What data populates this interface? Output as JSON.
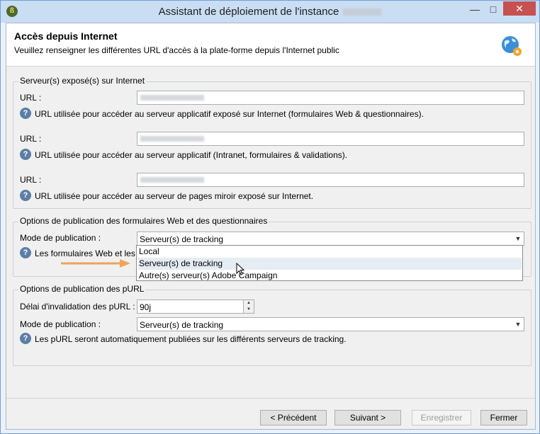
{
  "window": {
    "title": "Assistant de déploiement de l'instance",
    "title_suffix_redacted": ""
  },
  "header": {
    "title": "Accès depuis Internet",
    "subtitle": "Veuillez renseigner les différentes URL d'accès à la plate-forme depuis l'Internet public"
  },
  "servers": {
    "legend": "Serveur(s) exposé(s) sur Internet",
    "rows": [
      {
        "label": "URL :",
        "help": "URL utilisée pour accéder au serveur applicatif exposé sur Internet (formulaires Web & questionnaires)."
      },
      {
        "label": "URL :",
        "help": "URL utilisée pour accéder au serveur applicatif (Intranet, formulaires & validations)."
      },
      {
        "label": "URL :",
        "help": "URL utilisée pour accéder au serveur de pages miroir exposé sur Internet."
      }
    ]
  },
  "forms": {
    "legend": "Options de publication des formulaires Web et des questionnaires",
    "mode_label": "Mode de publication :",
    "mode_value": "Serveur(s) de tracking",
    "help": "Les formulaires Web et les q",
    "options": [
      "Local",
      "Serveur(s) de tracking",
      "Autre(s) serveur(s) Adobe Campaign"
    ]
  },
  "purl": {
    "legend": "Options de publication des pURL",
    "delay_label": "Délai d'invalidation des pURL :",
    "delay_value": "90j",
    "mode_label": "Mode de publication :",
    "mode_value": "Serveur(s) de tracking",
    "help": "Les pURL seront automatiquement publiées sur les différents serveurs de tracking."
  },
  "buttons": {
    "prev": "< Précédent",
    "next": "Suivant >",
    "save": "Enregistrer",
    "close": "Fermer"
  },
  "colors": {
    "accent_arrow": "#f0a35a",
    "title_bar": "#c9ddf3",
    "close_button": "#c75050"
  }
}
